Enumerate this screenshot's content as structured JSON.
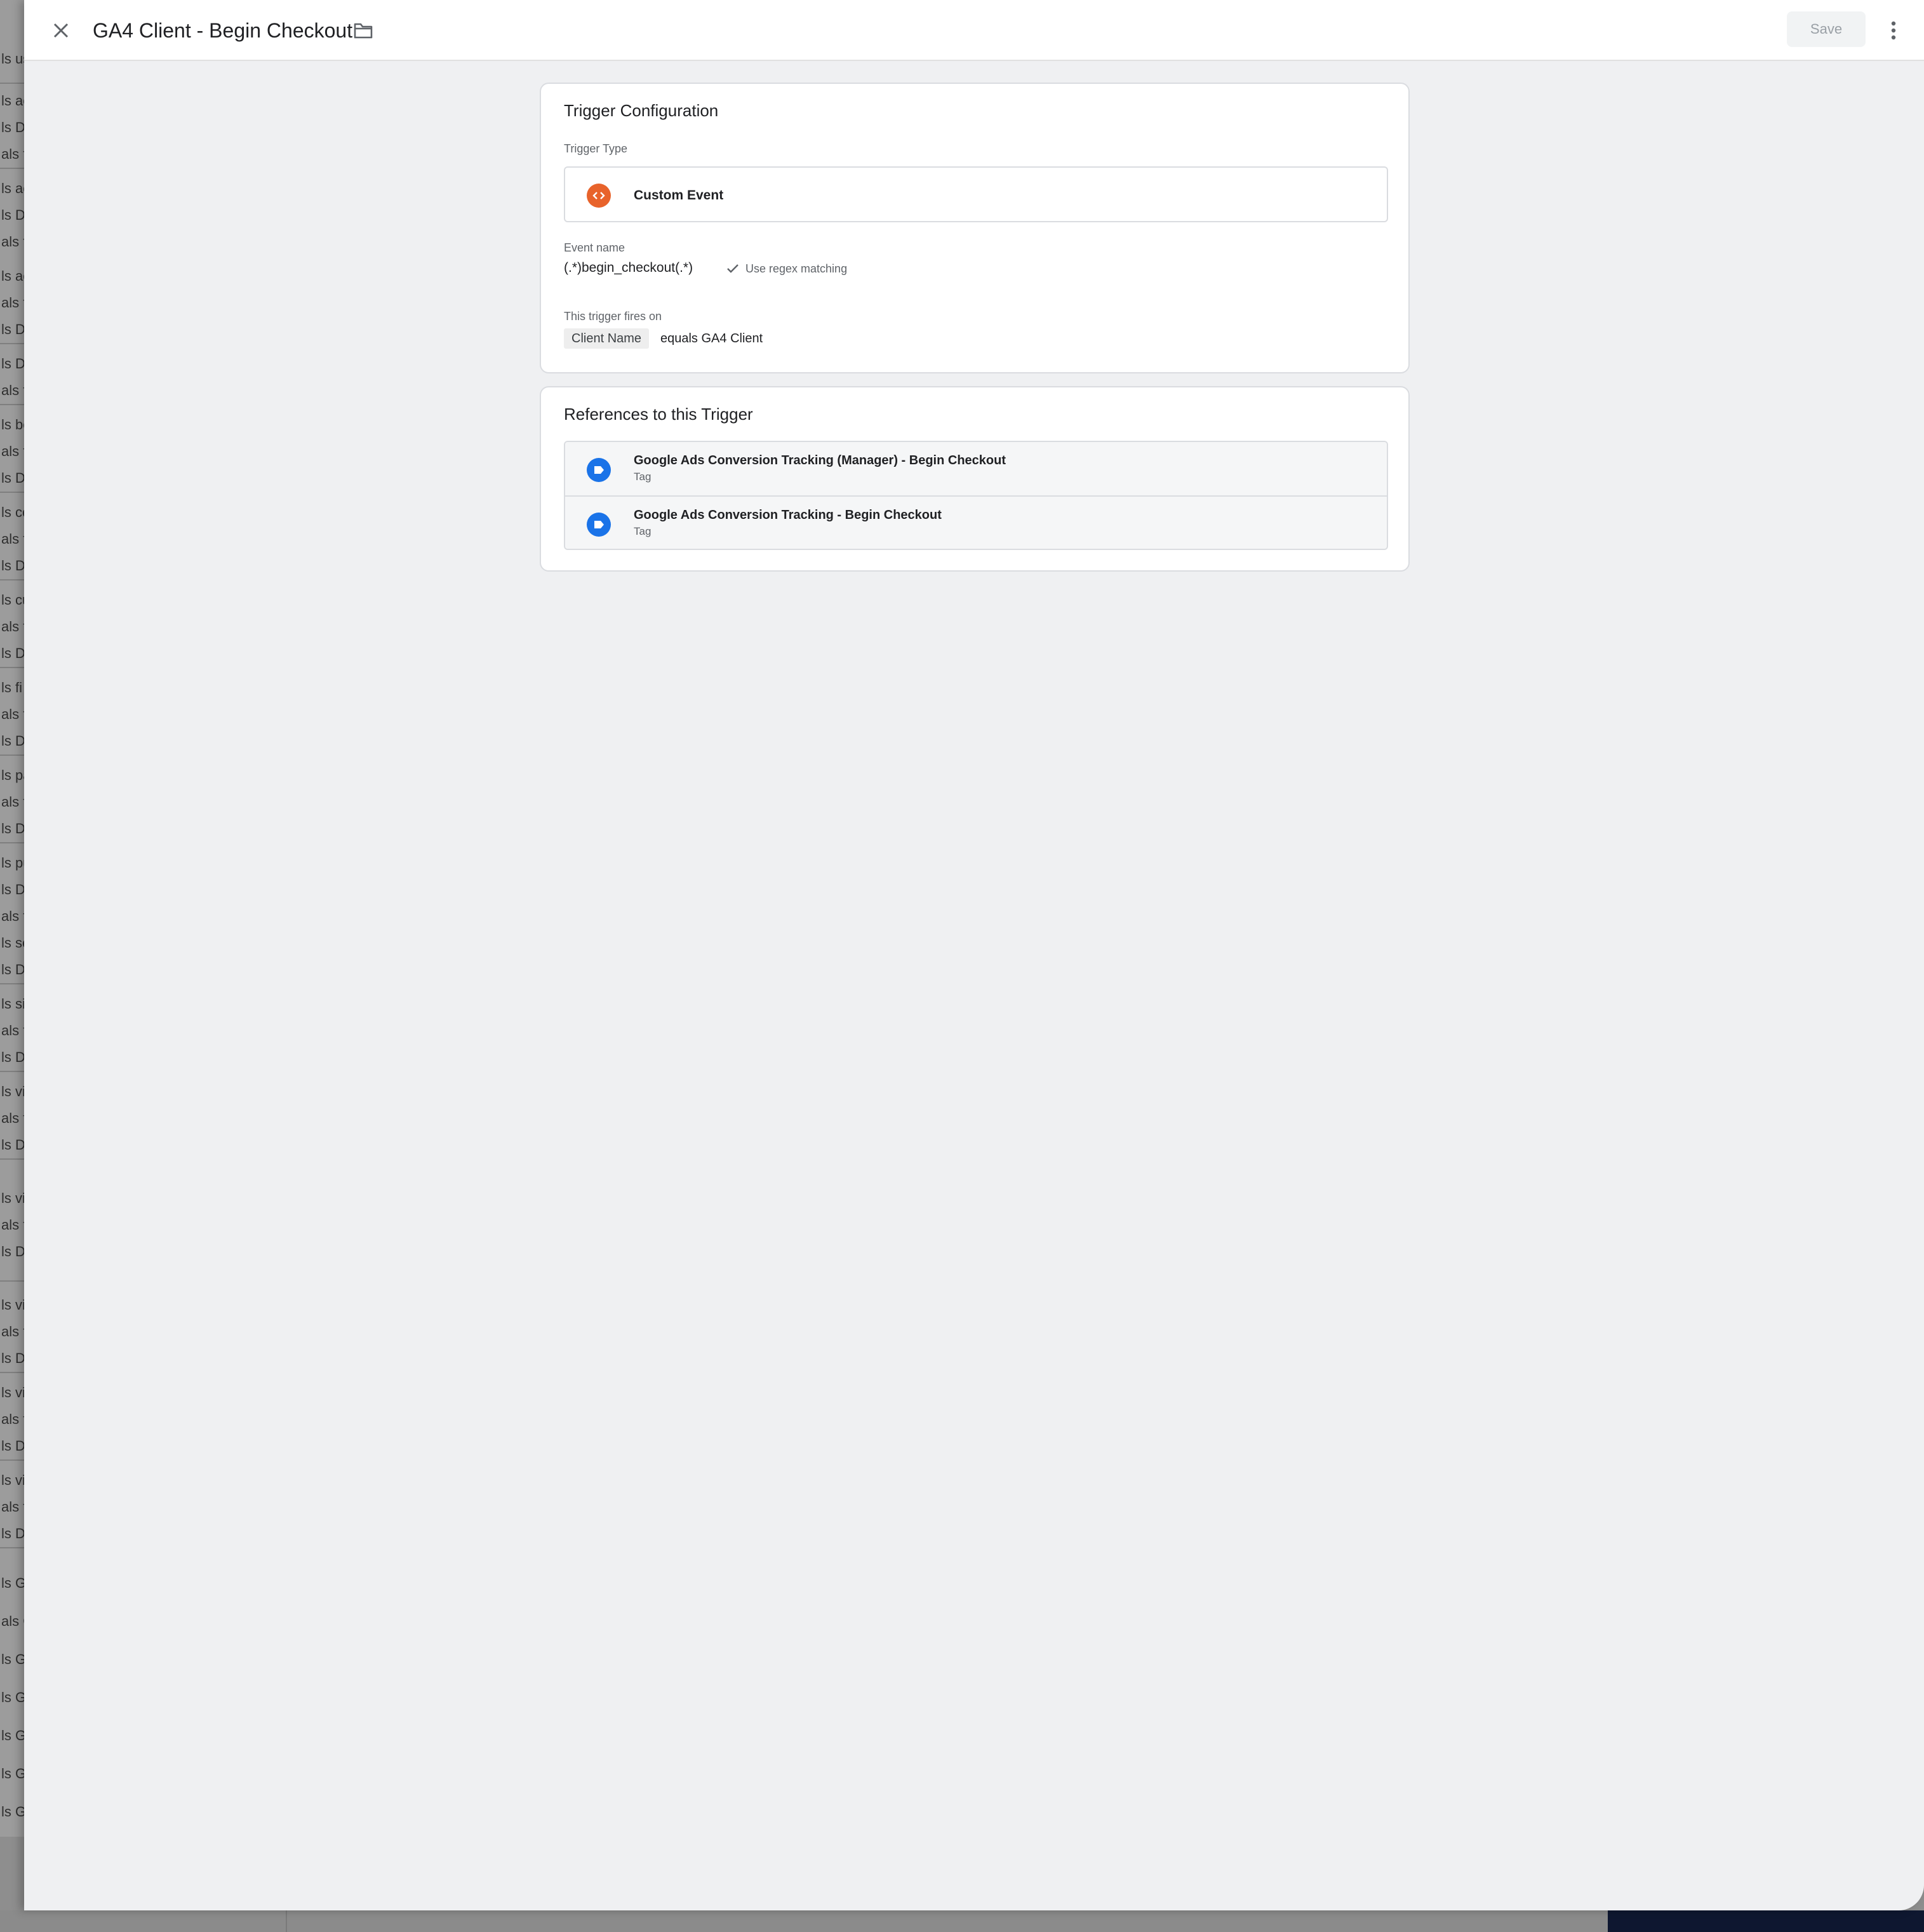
{
  "background_list": {
    "rows": [
      "ls us",
      "ls ac",
      "ls D",
      "als f",
      "ls ac",
      "ls D",
      "als f",
      "ls ac",
      "als f",
      "ls D",
      "ls D",
      "als f",
      "ls be",
      "als f",
      "ls D",
      "ls co",
      "als f",
      "ls D",
      "ls cu",
      "als f",
      "ls D",
      "ls fi",
      "als f",
      "ls D",
      "ls pa",
      "als f",
      "ls D",
      "ls pu",
      "ls D",
      "als f",
      "ls se",
      "ls D",
      "ls si",
      "als f",
      "ls D",
      "ls vi",
      "als f",
      "ls D",
      "ls vi",
      "als f",
      "ls D",
      "ls vi",
      "als f",
      "ls D",
      "ls vi",
      "als f",
      "ls D",
      "ls vi",
      "als f",
      "ls D",
      "ls G",
      "als G",
      "ls G",
      "ls G",
      "ls G",
      "ls G",
      "ls G"
    ]
  },
  "header": {
    "title": "GA4 Client - Begin Checkout",
    "save_label": "Save"
  },
  "trigger_config": {
    "heading": "Trigger Configuration",
    "type_label": "Trigger Type",
    "type_name": "Custom Event",
    "event_name_label": "Event name",
    "event_name_value": "(.*)begin_checkout(.*)",
    "regex_label": "Use regex matching",
    "fires_on_label": "This trigger fires on",
    "condition_variable": "Client Name",
    "condition_text": "equals GA4 Client"
  },
  "references": {
    "heading": "References to this Trigger",
    "items": [
      {
        "name": "Google Ads Conversion Tracking (Manager) - Begin Checkout",
        "type": "Tag"
      },
      {
        "name": "Google Ads Conversion Tracking - Begin Checkout",
        "type": "Tag"
      }
    ]
  },
  "colors": {
    "custom_event_icon": "#e8632b",
    "tag_icon": "#1a73e8",
    "panel_bg": "#eff0f2"
  },
  "icons": {
    "close": "close-icon",
    "folder": "folder-icon",
    "more": "more-vert-icon",
    "custom_event": "code-brackets-icon",
    "tag": "tag-label-icon",
    "check": "check-icon"
  }
}
